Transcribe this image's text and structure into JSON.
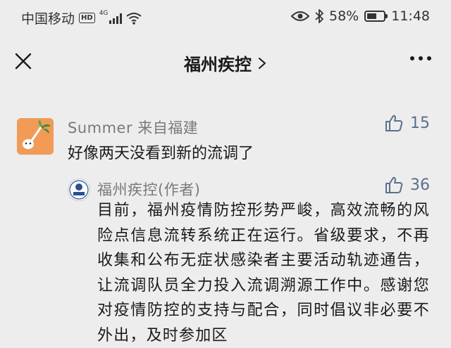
{
  "status_bar": {
    "carrier": "中国移动",
    "hd": "HD",
    "network": "4G",
    "battery_percent": "58%",
    "battery_level": 0.58,
    "time": "11:48"
  },
  "header": {
    "title": "福州疾控",
    "close_icon": "close-icon",
    "chevron_icon": "chevron-right-icon",
    "more_icon": "more-dots-icon"
  },
  "comment": {
    "user_name": "Summer",
    "location": "来自福建",
    "likes": "15",
    "text": "好像两天没看到新的流调了"
  },
  "reply": {
    "author": "福州疾控(作者)",
    "likes": "36",
    "text": "目前，福州疫情防控形势严峻，高效流畅的风险点信息流转系统正在运行。省级要求，不再收集和公布无症状感染者主要活动轨迹通告，让流调队员全力投入流调溯源工作中。感谢您对疫情防控的支持与配合，同时倡议非必要不外出，及时参加区"
  },
  "colors": {
    "background": "#ededed",
    "name_gray": "#7a7a7a",
    "like_blue": "#5c6f8c",
    "avatar_orange": "#f29a57"
  }
}
